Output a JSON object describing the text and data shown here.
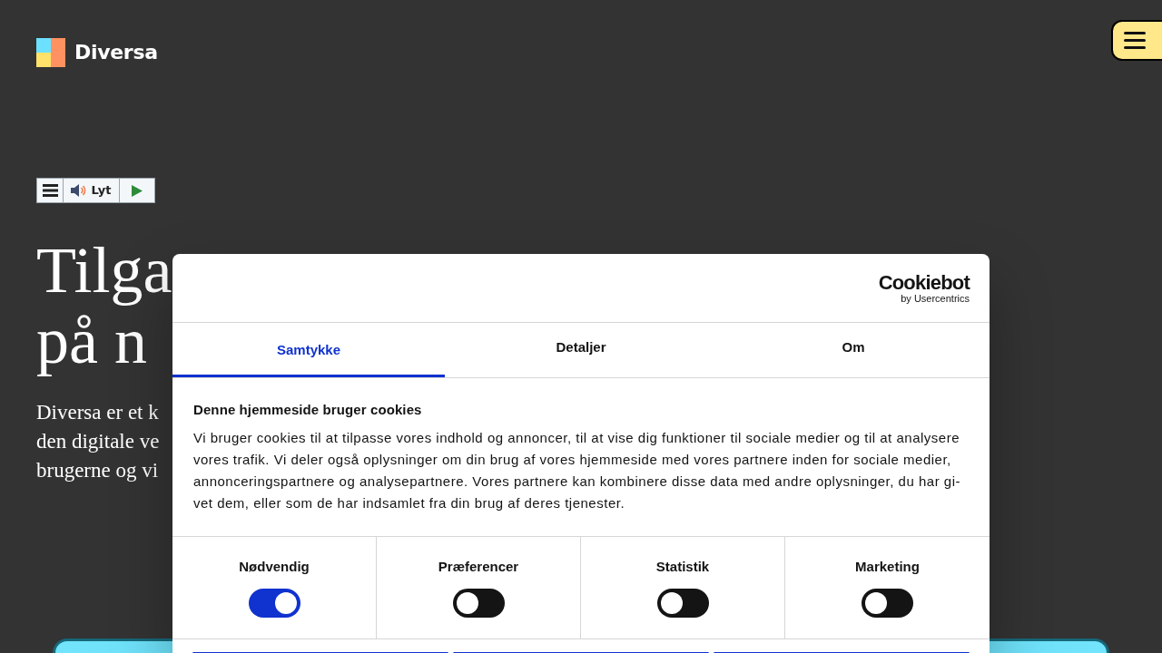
{
  "site": {
    "logo": "Diversa"
  },
  "read_aloud": {
    "label": "Lyt"
  },
  "hero": {
    "heading_lines": [
      "Tilga",
      "på n"
    ],
    "intro_lines": [
      "Diversa er et k",
      "den digitale ve",
      "brugerne og vi"
    ]
  },
  "cookie_dialog": {
    "brand": {
      "name": "Cookiebot",
      "tagline": "by Usercentrics"
    },
    "tabs": [
      {
        "label": "Samtykke",
        "selected": true
      },
      {
        "label": "Detaljer",
        "selected": false
      },
      {
        "label": "Om",
        "selected": false
      }
    ],
    "title": "Denne hjemmeside bruger cookies",
    "body": "Vi bruger cookies til at tilpasse vores indhold og annoncer, til at vise dig funktioner til sociale medier og til at analysere vores trafik. Vi deler også oplysninger om din brug af vores hjemmeside med vores partnere inden for sociale medier, annonceringspartnere og analysepartnere. Vores partnere kan kombinere disse data med andre oplysninger, du har gi-vet dem, eller som de har indsamlet fra din brug af deres tjenester.",
    "categories": [
      {
        "label": "Nødvendig",
        "on": true
      },
      {
        "label": "Præferencer",
        "on": false
      },
      {
        "label": "Statistik",
        "on": false
      },
      {
        "label": "Marketing",
        "on": false
      }
    ]
  }
}
